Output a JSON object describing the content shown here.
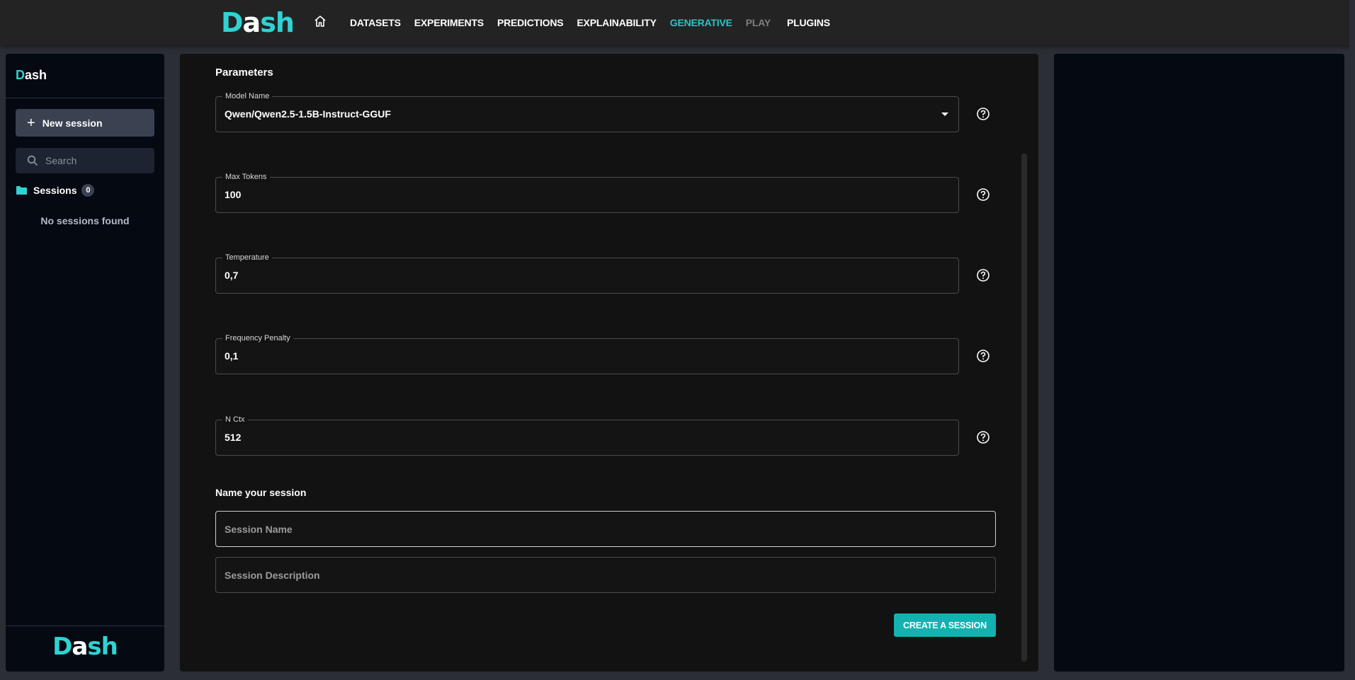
{
  "app": {
    "logo_part1": "D",
    "logo_part2": "a",
    "logo_part3": "sh"
  },
  "nav": {
    "home_icon": "home-icon",
    "items": [
      {
        "label": "DATASETS",
        "state": "normal"
      },
      {
        "label": "EXPERIMENTS",
        "state": "normal"
      },
      {
        "label": "PREDICTIONS",
        "state": "normal"
      },
      {
        "label": "EXPLAINABILITY",
        "state": "normal"
      },
      {
        "label": "GENERATIVE",
        "state": "active"
      },
      {
        "label": "PLAY",
        "state": "disabled"
      },
      {
        "label": "PLUGINS",
        "state": "normal"
      }
    ]
  },
  "sidebar": {
    "title_accent": "D",
    "title_rest": "ash",
    "new_session_label": "New session",
    "search_placeholder": "Search",
    "sessions_label": "Sessions",
    "sessions_count": "0",
    "empty_text": "No sessions found",
    "footer_logo_a": "D",
    "footer_logo_b": "a",
    "footer_logo_c": "sh"
  },
  "main": {
    "parameters_title": "Parameters",
    "fields": {
      "model_name": {
        "label": "Model Name",
        "value": "Qwen/Qwen2.5-1.5B-Instruct-GGUF"
      },
      "max_tokens": {
        "label": "Max Tokens",
        "value": "100"
      },
      "temperature": {
        "label": "Temperature",
        "value": "0,7"
      },
      "frequency_penalty": {
        "label": "Frequency Penalty",
        "value": "0,1"
      },
      "n_ctx": {
        "label": "N Ctx",
        "value": "512"
      }
    },
    "name_title": "Name your session",
    "session_name_placeholder": "Session Name",
    "session_description_placeholder": "Session Description",
    "create_button_label": "CREATE A SESSION"
  },
  "colors": {
    "accent": "#2fd3d3",
    "button": "#14b1b1",
    "nav_active": "#29c6c6"
  }
}
